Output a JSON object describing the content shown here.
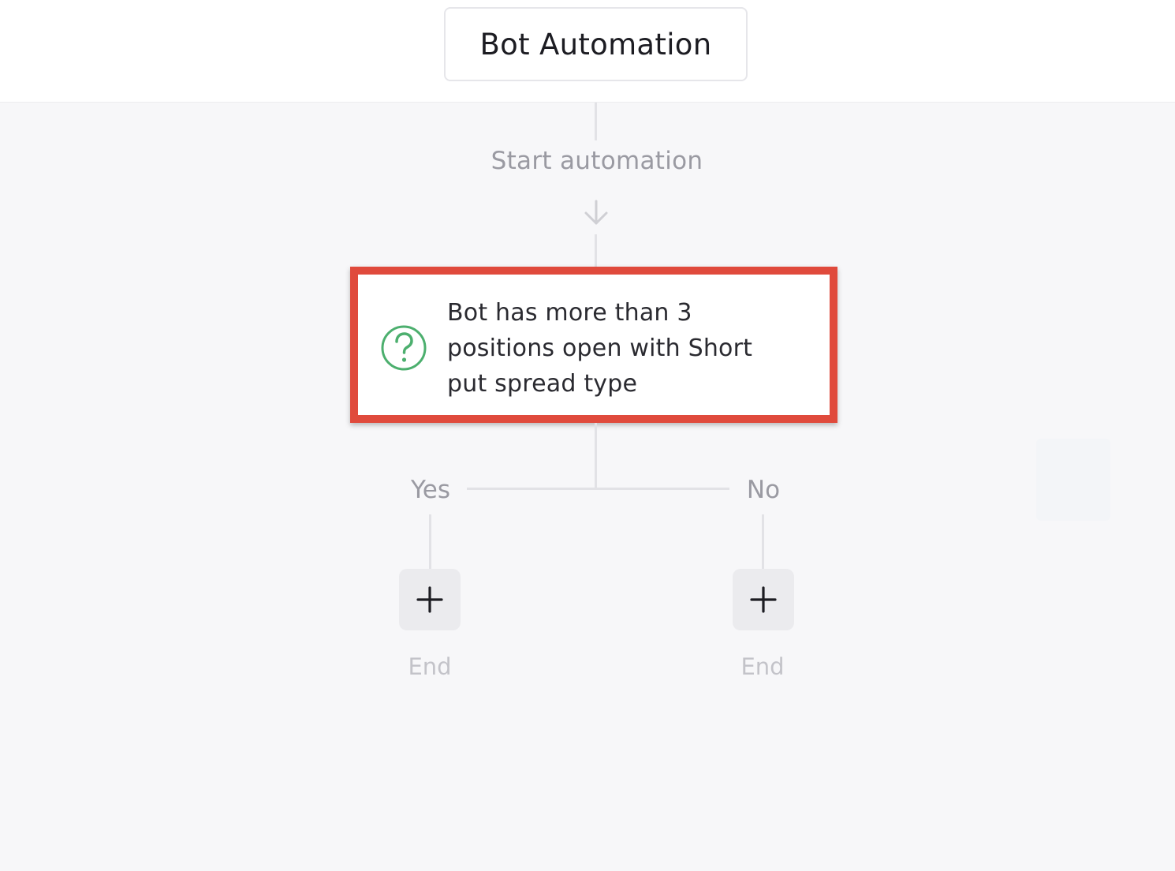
{
  "header": {
    "title": "Bot Automation"
  },
  "flow": {
    "start_label": "Start automation",
    "condition": {
      "icon": "question-circle-icon",
      "text": "Bot has more than 3 positions open with Short put spread type",
      "highlight_color": "#e04a3c",
      "icon_color": "#4caf6e"
    },
    "branches": {
      "yes": {
        "label": "Yes",
        "add_icon": "plus-icon",
        "end_label": "End"
      },
      "no": {
        "label": "No",
        "add_icon": "plus-icon",
        "end_label": "End"
      }
    }
  }
}
